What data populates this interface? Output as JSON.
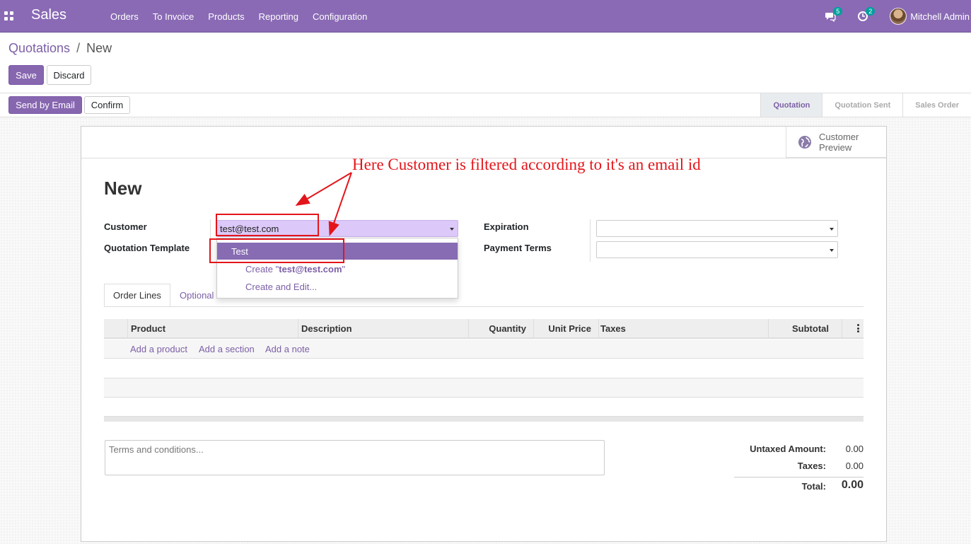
{
  "app": {
    "name": "Sales",
    "menu": [
      "Orders",
      "To Invoice",
      "Products",
      "Reporting",
      "Configuration"
    ],
    "messages_count": "5",
    "activities_count": "2",
    "user": "Mitchell Admin"
  },
  "breadcrumb": {
    "parent": "Quotations",
    "separator": "/",
    "current": "New"
  },
  "buttons": {
    "save": "Save",
    "discard": "Discard",
    "send_by_email": "Send by Email",
    "confirm": "Confirm"
  },
  "stages": [
    "Quotation",
    "Quotation Sent",
    "Sales Order"
  ],
  "active_stage": "Quotation",
  "customer_preview": {
    "label": "Customer Preview",
    "icon": "globe-icon"
  },
  "form": {
    "title": "New",
    "customer_label": "Customer",
    "customer_value": "test@test.com",
    "quotation_template_label": "Quotation Template",
    "expiration_label": "Expiration",
    "payment_terms_label": "Payment Terms"
  },
  "autocomplete": {
    "match": "Test",
    "create_prefix": "Create \"",
    "create_value": "test@test.com",
    "create_suffix": "\"",
    "create_and_edit": "Create and Edit..."
  },
  "tabs": [
    "Order Lines",
    "Optional"
  ],
  "table": {
    "columns": [
      "Product",
      "Description",
      "Quantity",
      "Unit Price",
      "Taxes",
      "Subtotal"
    ],
    "add_product": "Add a product",
    "add_section": "Add a section",
    "add_note": "Add a note"
  },
  "terms_placeholder": "Terms and conditions...",
  "totals": {
    "untaxed_label": "Untaxed Amount:",
    "untaxed_value": "0.00",
    "taxes_label": "Taxes:",
    "taxes_value": "0.00",
    "total_label": "Total:",
    "total_value": "0.00"
  },
  "annotation": "Here Customer is filtered according to it's an email id",
  "colors": {
    "brand": "#8766b0",
    "link": "#7c5fa6",
    "annotation": "#e4151a"
  }
}
